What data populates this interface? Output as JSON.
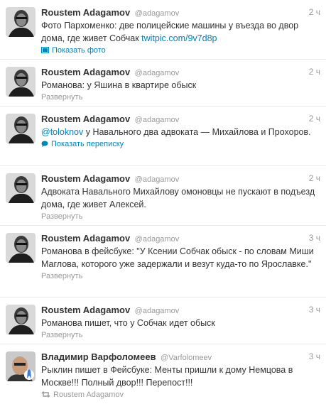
{
  "tweets": [
    {
      "name": "Roustem Adagamov",
      "handle": "@adagamov",
      "time": "2 ч",
      "text": "Фото Пархоменко: две полицейские машины у въезда во двор дома, где живет Собчак ",
      "link": "twitpic.com/9v7d8p",
      "action": "Показать фото",
      "action_icon": "photo-icon"
    },
    {
      "name": "Roustem Adagamov",
      "handle": "@adagamov",
      "time": "2 ч",
      "text": "Романова: у Яшина в квартире обыск",
      "action": "Развернуть"
    },
    {
      "name": "Roustem Adagamov",
      "handle": "@adagamov",
      "time": "2 ч",
      "mention": "@toloknov",
      "text": " у Навального два адвоката — Михайлова и Прохоров.",
      "action": "Показать переписку",
      "action_icon": "conversation-icon"
    },
    {
      "name": "Roustem Adagamov",
      "handle": "@adagamov",
      "time": "2 ч",
      "text": "Адвоката Навального Михайлову омоновцы не пускают в подъезд дома, где живет Алексей.",
      "action": "Развернуть"
    },
    {
      "name": "Roustem Adagamov",
      "handle": "@adagamov",
      "time": "3 ч",
      "text": "Романова в фейсбуке: \"У Ксении Собчак обыск - по словам Миши Маглова, которого уже задержали и везут куда-то по Ярославке.\"",
      "action": "Развернуть"
    },
    {
      "name": "Roustem Adagamov",
      "handle": "@adagamov",
      "time": "3 ч",
      "text": "Романова пишет, что у Собчак идет обыск",
      "action": "Развернуть"
    },
    {
      "name": "Владимир Варфоломеев",
      "handle": "@Varfolomeev",
      "time": "3 ч",
      "text": "Рыклин пишет в Фейсбуке: Менты пришли к дому Немцова в Москве!!! Полный двор!!! Перепост!!!",
      "action": "Roustem Adagamov",
      "action_icon": "retweet-icon"
    }
  ],
  "colors": {
    "link": "#0084b4",
    "meta": "#999999",
    "text": "#333333",
    "divider": "#e8e8e8"
  }
}
